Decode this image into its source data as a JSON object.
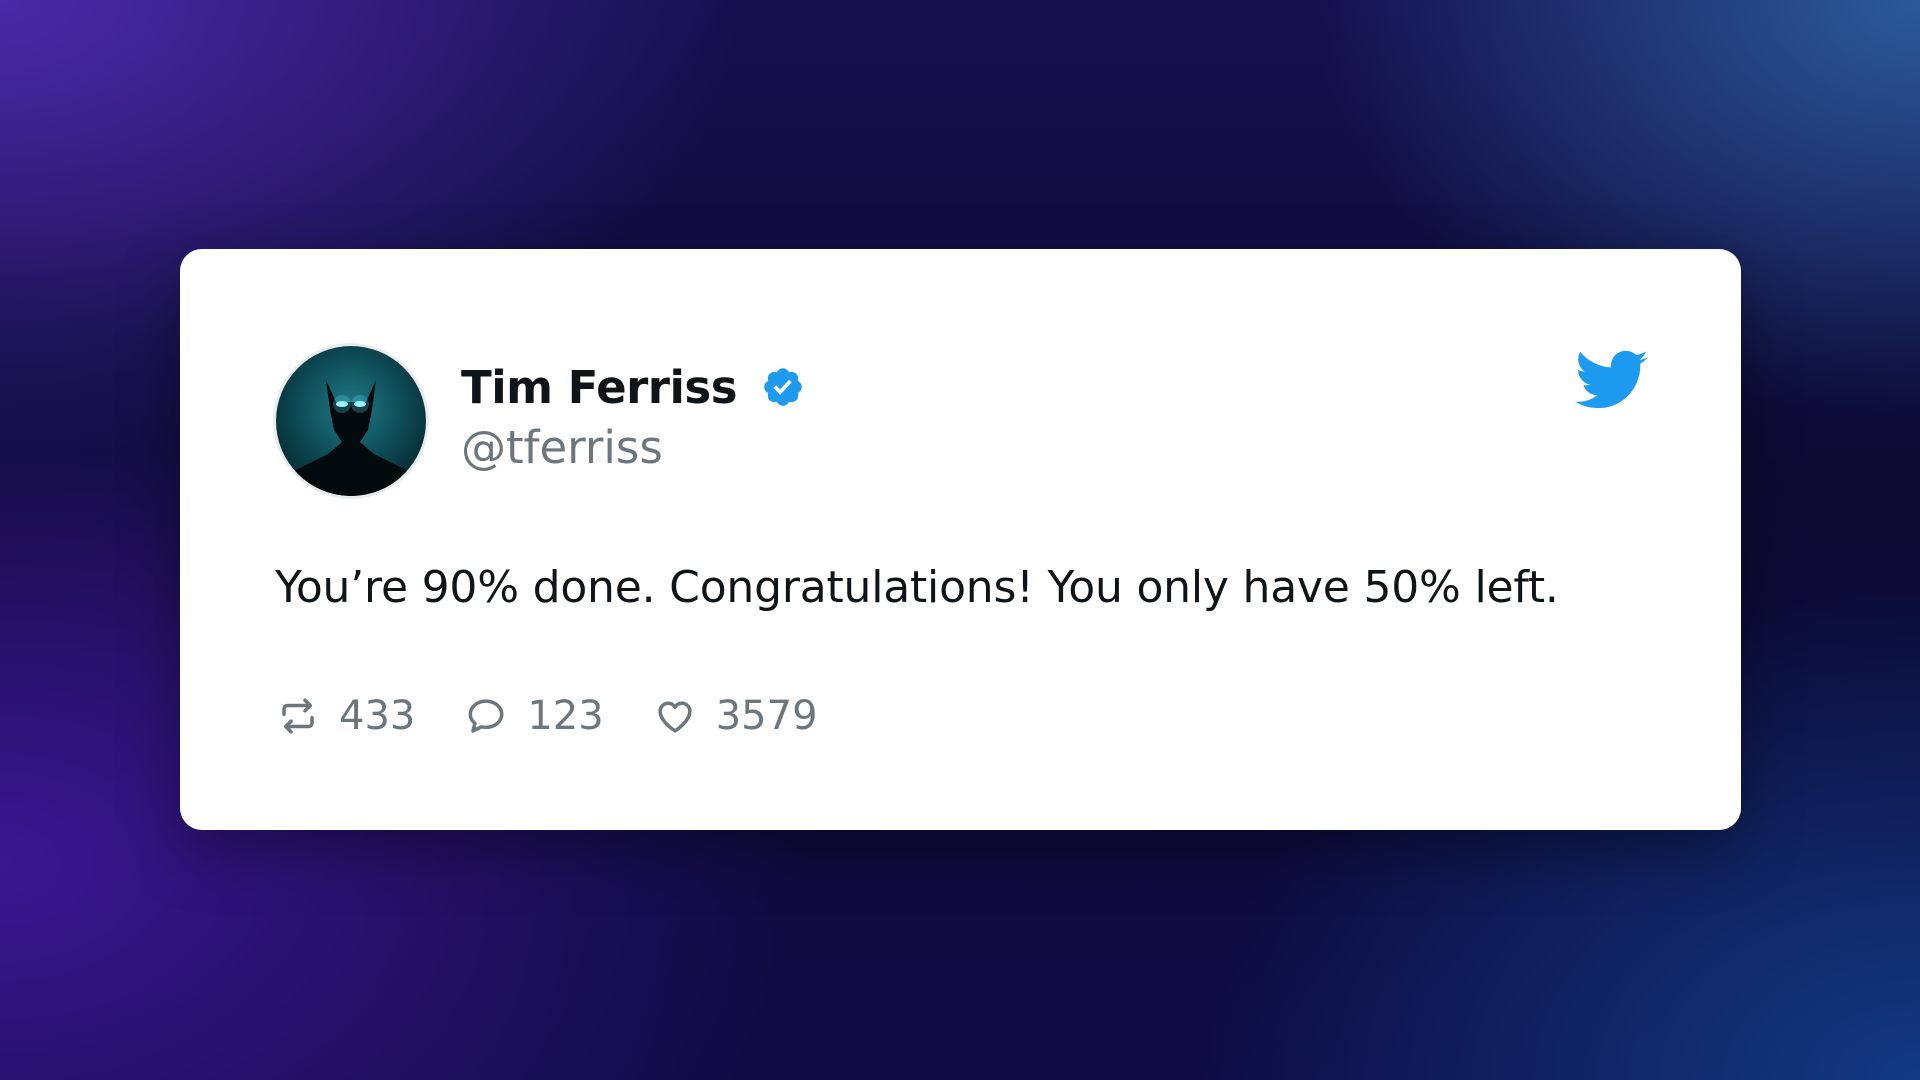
{
  "tweet": {
    "author": {
      "display_name": "Tim Ferriss",
      "handle": "@tferriss",
      "verified": true
    },
    "text": "You’re 90% done. Congratulations! You only have 50% left.",
    "stats": {
      "retweets": "433",
      "replies": "123",
      "likes": "3579"
    },
    "icons": {
      "platform": "twitter-bird-icon",
      "verified": "verified-badge-icon",
      "retweet": "retweet-icon",
      "reply": "reply-icon",
      "like": "heart-icon"
    }
  },
  "colors": {
    "brand_blue": "#1d9bf0",
    "text_primary": "#0f1419",
    "text_secondary": "#6e767d",
    "card_background": "#ffffff"
  }
}
